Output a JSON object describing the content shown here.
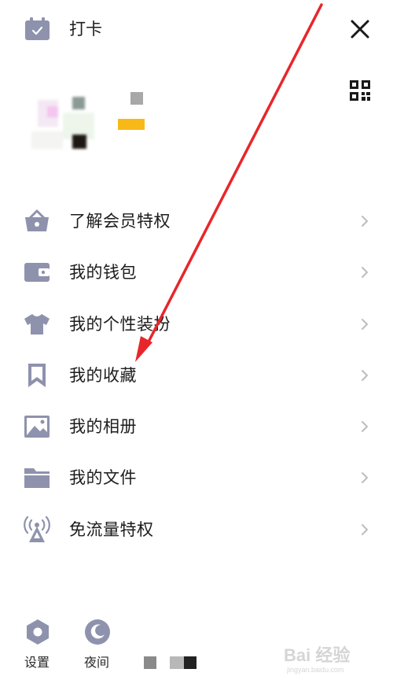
{
  "header": {
    "checkin_label": "打卡",
    "close_icon": "close-icon",
    "qr_icon": "qr-code-icon"
  },
  "menu": {
    "items": [
      {
        "label": "了解会员特权",
        "icon": "crown-basket-icon"
      },
      {
        "label": "我的钱包",
        "icon": "wallet-icon"
      },
      {
        "label": "我的个性装扮",
        "icon": "tshirt-icon"
      },
      {
        "label": "我的收藏",
        "icon": "bookmark-icon"
      },
      {
        "label": "我的相册",
        "icon": "photo-icon"
      },
      {
        "label": "我的文件",
        "icon": "folder-icon"
      },
      {
        "label": "免流量特权",
        "icon": "antenna-icon"
      }
    ]
  },
  "bottom": {
    "settings_label": "设置",
    "night_label": "夜间"
  },
  "watermark": {
    "text": "Bai 经验",
    "subtext": "jingyan.baidu.com"
  },
  "colors": {
    "icon": "#8e92ad",
    "text": "#1c1c1c",
    "chevron": "#bdbdbd",
    "arrow": "#e8262a"
  }
}
